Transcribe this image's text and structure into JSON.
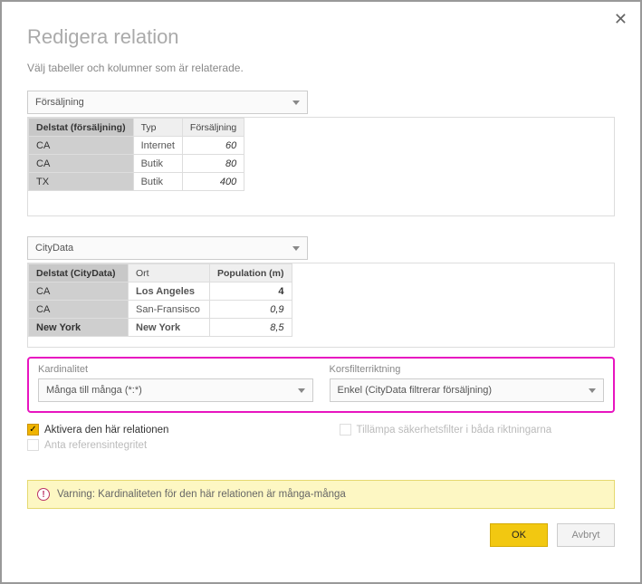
{
  "dialog": {
    "title": "Redigera relation",
    "subtitle": "Välj tabeller och kolumner som är relaterade.",
    "close": "✕"
  },
  "table1": {
    "selected": "Försäljning",
    "cols": [
      "Delstat (försäljning)",
      "Typ",
      "Försäljning"
    ],
    "rows": [
      {
        "c0": "CA",
        "c1": "Internet",
        "c2": "60"
      },
      {
        "c0": "CA",
        "c1": "Butik",
        "c2": "80"
      },
      {
        "c0": "TX",
        "c1": "Butik",
        "c2": "400"
      }
    ]
  },
  "table2": {
    "selected": "CityData",
    "cols": [
      "Delstat (CityData)",
      "Ort",
      "Population (m)"
    ],
    "rows": [
      {
        "c0": "CA",
        "c1": "Los Angeles",
        "c2": "4"
      },
      {
        "c0": "CA",
        "c1": "San-Fransisco",
        "c2": "0,9"
      },
      {
        "c0": "New York",
        "c1": "New York",
        "c2": "8,5"
      }
    ]
  },
  "card": {
    "label_left": "Kardinalitet",
    "value_left": "Många till många (*:*)",
    "label_right": "Korsfilterriktning",
    "value_right": "Enkel (CityData filtrerar försäljning)"
  },
  "checks": {
    "activate": "Aktivera den här relationen",
    "integrity": "Anta referensintegritet",
    "security": "Tillämpa säkerhetsfilter i båda riktningarna"
  },
  "warning": "Varning: Kardinaliteten för den här relationen är många-många",
  "buttons": {
    "ok": "OK",
    "cancel": "Avbryt"
  }
}
